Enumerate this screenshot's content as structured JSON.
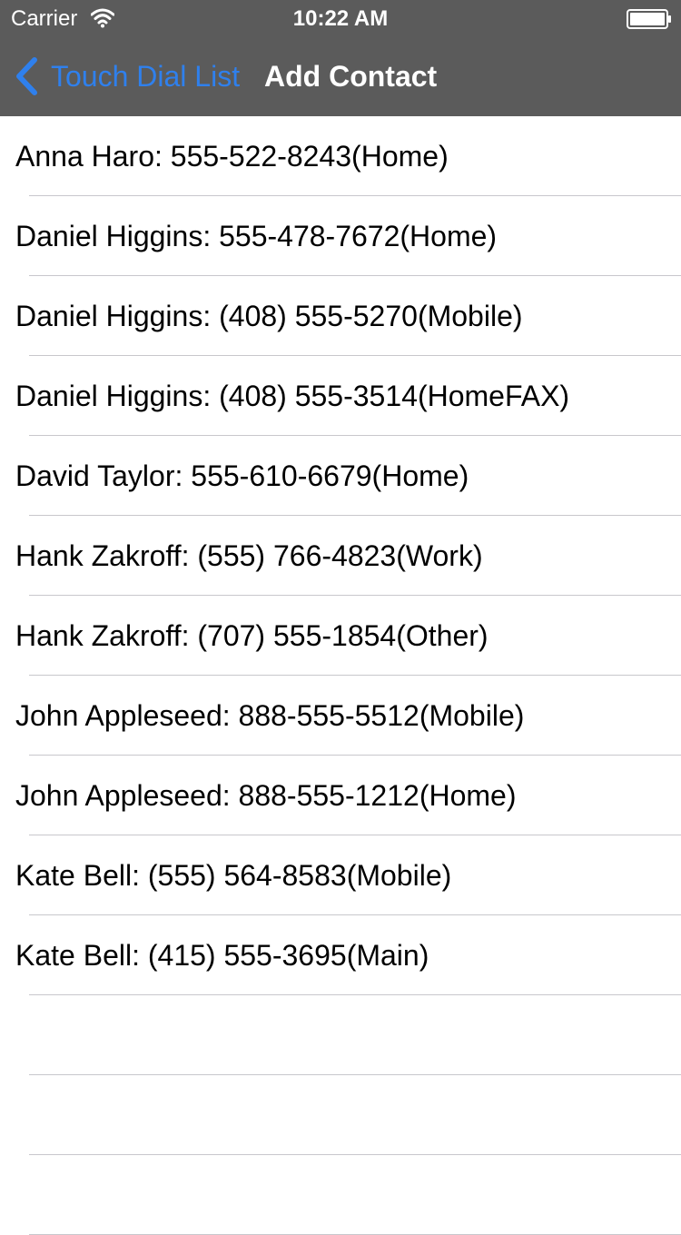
{
  "status_bar": {
    "carrier": "Carrier",
    "time": "10:22 AM",
    "wifi_icon": "wifi-icon",
    "battery_icon": "battery-icon"
  },
  "nav": {
    "back_label": "Touch Dial List",
    "back_icon": "chevron-left-icon",
    "title": "Add Contact",
    "bar_color": "#5b5b5b",
    "accent_color": "#2f80ed"
  },
  "contacts": [
    "Anna Haro: 555-522-8243(Home)",
    "Daniel Higgins: 555-478-7672(Home)",
    "Daniel Higgins: (408) 555-5270(Mobile)",
    "Daniel Higgins: (408) 555-3514(HomeFAX)",
    "David Taylor: 555-610-6679(Home)",
    "Hank Zakroff: (555) 766-4823(Work)",
    "Hank Zakroff: (707) 555-1854(Other)",
    "John Appleseed: 888-555-5512(Mobile)",
    "John Appleseed: 888-555-1212(Home)",
    "Kate Bell: (555) 564-8583(Mobile)",
    "Kate Bell: (415) 555-3695(Main)"
  ],
  "empty_rows": 3
}
